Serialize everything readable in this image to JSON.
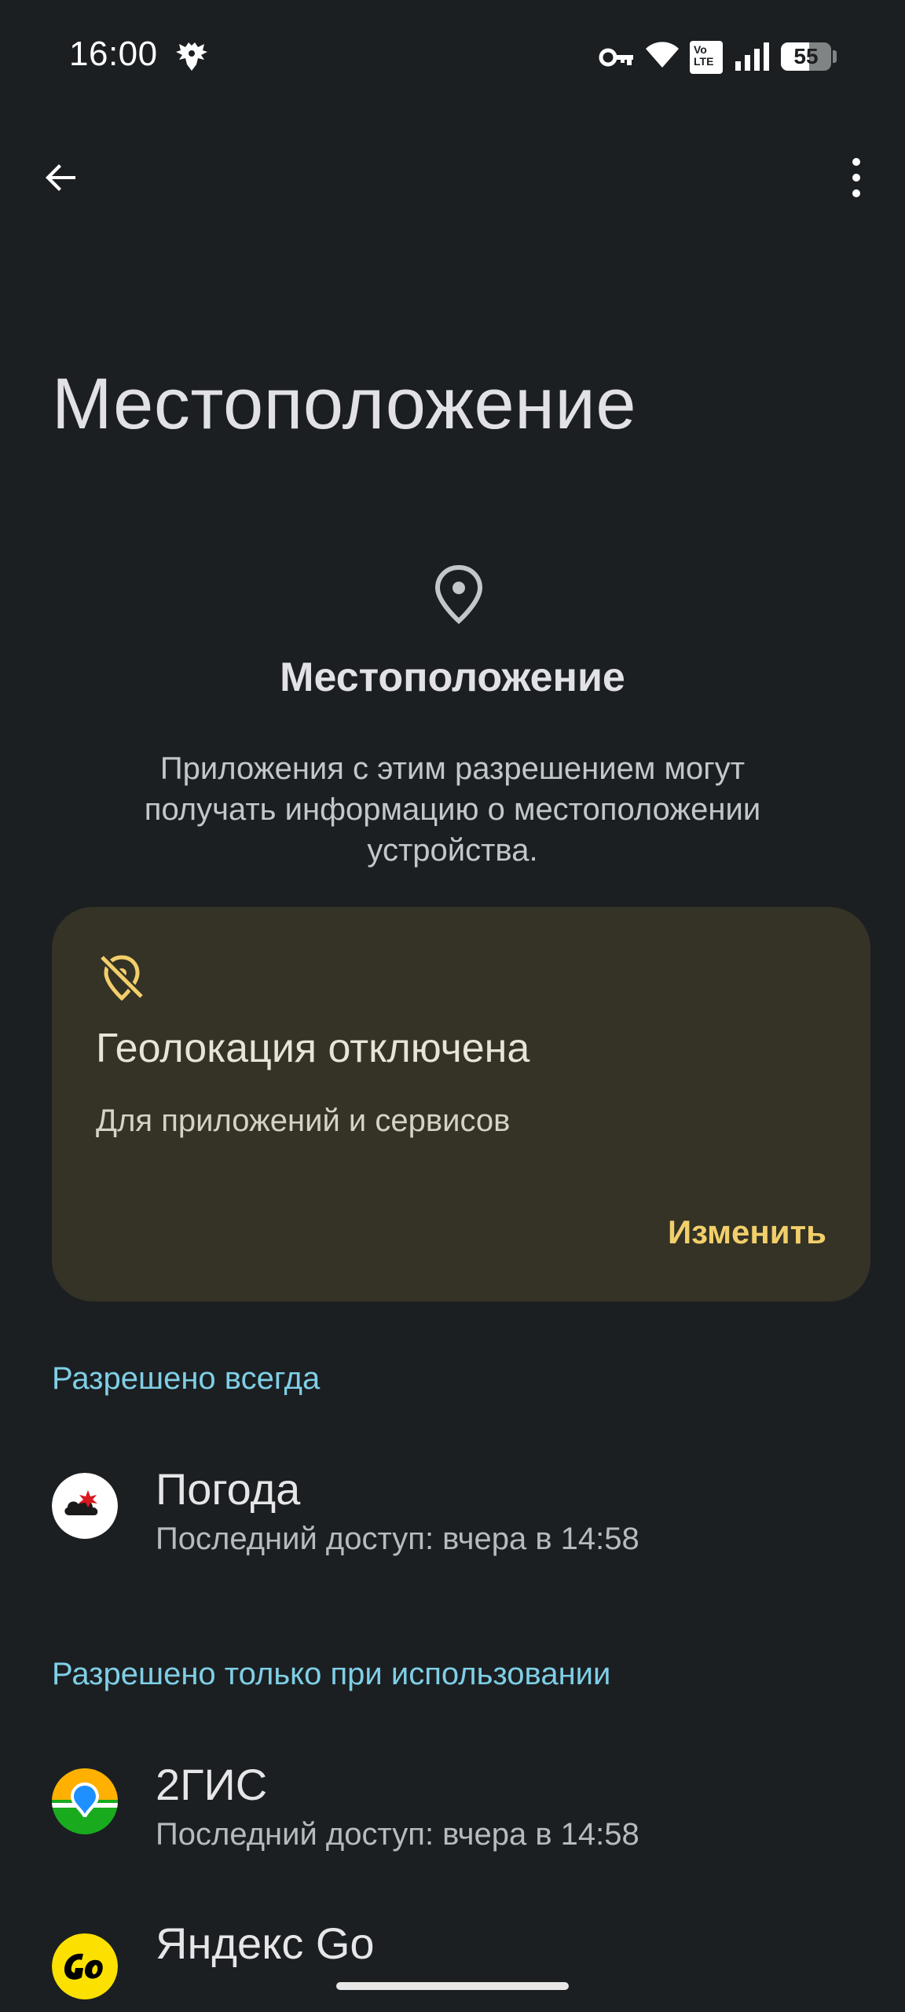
{
  "status_bar": {
    "time": "16:00",
    "icons": [
      "eagle-icon",
      "vpn-key-icon",
      "wifi-icon",
      "volte-icon",
      "signal-icon",
      "battery-icon"
    ],
    "volte_label_top": "Vo",
    "volte_label_bottom": "LTE",
    "battery_level": "55"
  },
  "top_bar": {
    "back_icon": "arrow-back-icon",
    "more_icon": "more-vert-icon"
  },
  "page_title": "Местоположение",
  "header": {
    "icon": "location-pin-icon",
    "title": "Местоположение",
    "description": "Приложения с этим разрешением могут получать информацию о местоположении устройства."
  },
  "warning_card": {
    "icon": "location-off-icon",
    "title": "Геолокация отключена",
    "subtitle": "Для приложений и сервисов",
    "action": "Изменить",
    "accent_color": "#f2cf6a",
    "background_color": "#353226"
  },
  "sections": [
    {
      "label": "Разрешено всегда",
      "apps": [
        {
          "name": "Погода",
          "subtitle": "Последний доступ: вчера в 14:58",
          "icon": "weather-app-icon"
        }
      ]
    },
    {
      "label": "Разрешено только при использовании",
      "apps": [
        {
          "name": "2ГИС",
          "subtitle": "Последний доступ: вчера в 14:58",
          "icon": "2gis-app-icon"
        },
        {
          "name": "Яндекс Go",
          "subtitle": "",
          "icon": "yandex-go-app-icon"
        }
      ]
    }
  ],
  "colors": {
    "background": "#1b1f22",
    "category_label": "#7fcfe6"
  }
}
